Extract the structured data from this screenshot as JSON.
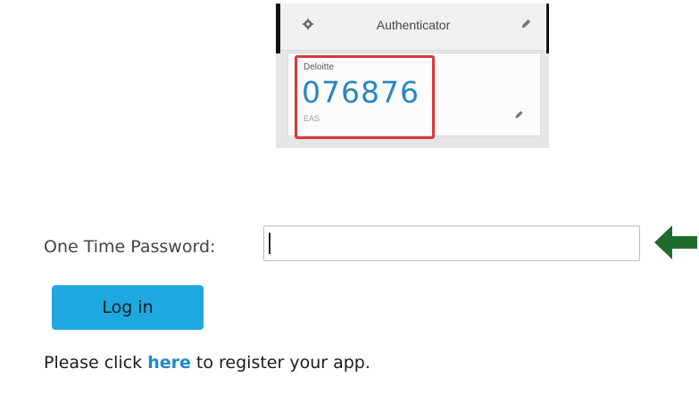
{
  "authenticator": {
    "title": "Authenticator",
    "account": "Deloitte",
    "code": "076876",
    "issuer": "EAS",
    "icons": {
      "settings": "gear-icon",
      "edit_top": "pencil-icon",
      "edit_card": "pencil-icon"
    },
    "colors": {
      "code": "#2a86c0",
      "highlight": "#d73a3a"
    }
  },
  "login_form": {
    "otp_label": "One Time Password:",
    "otp_value": "",
    "otp_placeholder": "",
    "arrow_icon": "arrow-left-icon",
    "arrow_color": "#1e6b2e",
    "login_label": "Log in",
    "button_color": "#1ea8e0",
    "register": {
      "before": "Please click ",
      "link": "here",
      "after": " to register your app."
    }
  }
}
